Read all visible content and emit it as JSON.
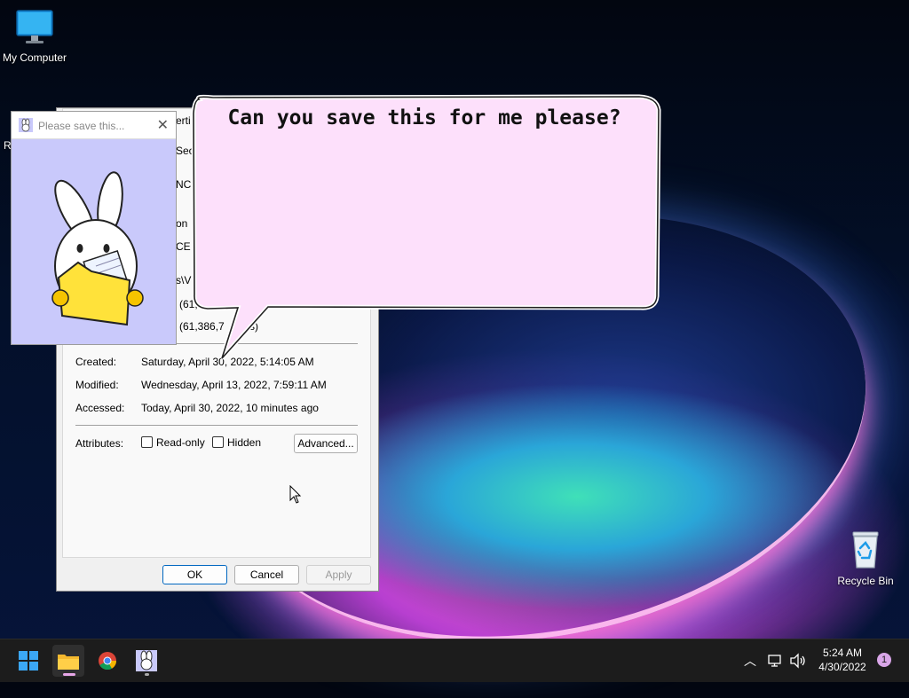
{
  "desktop": {
    "my_computer": "My Computer",
    "recycle_bin": "Recycle Bin",
    "left_icon_partial": "R"
  },
  "popup": {
    "title": "Please save this...",
    "close_glyph": "✕"
  },
  "bubble": {
    "text": "Can you save this for me please?"
  },
  "props": {
    "title_partial": "erti",
    "tab_partial": "Sec",
    "type_partial": "NCE",
    "open_partial": "on",
    "app_partial": "CE",
    "location_partial": "s\\VI",
    "size_partial": "(61,",
    "size_on_disk_partial": "(61,386,7",
    "size_on_disk_suffix": "s)",
    "created_label": "Created:",
    "created_value": "Saturday, April 30, 2022, 5:14:05 AM",
    "modified_label": "Modified:",
    "modified_value": "Wednesday, April 13, 2022, 7:59:11 AM",
    "accessed_label": "Accessed:",
    "accessed_value": "Today, April 30, 2022, 10 minutes ago",
    "attributes_label": "Attributes:",
    "readonly_label": "Read-only",
    "hidden_label": "Hidden",
    "advanced_label": "Advanced...",
    "ok_label": "OK",
    "cancel_label": "Cancel",
    "apply_label": "Apply"
  },
  "taskbar": {
    "time": "5:24 AM",
    "date": "4/30/2022",
    "notification_count": "1",
    "apps": [
      "start-icon",
      "file-explorer-icon",
      "chrome-icon",
      "bunny-app-icon"
    ]
  },
  "colors": {
    "bubble_fill": "#fde0fb",
    "popup_bg": "#c9c9fb",
    "accent": "#0067c0",
    "notification_badge": "#d9a6e8"
  }
}
